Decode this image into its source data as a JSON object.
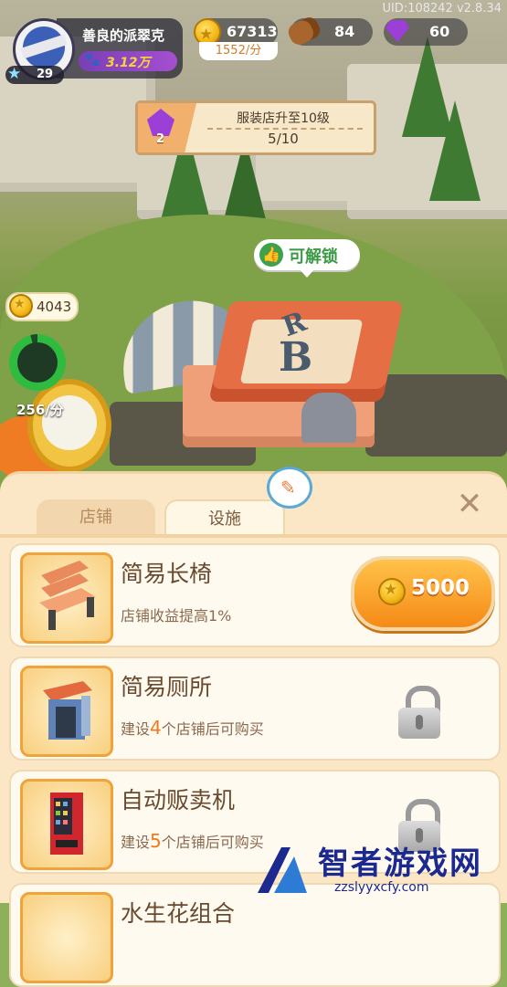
{
  "hud": {
    "uid": "UID:108242 v2.8.34",
    "player_name": "善良的派翠克",
    "fans": "3.12万",
    "level": "29",
    "coins": "67313",
    "coin_rate": "1552/分",
    "wood": "84",
    "gems": "60"
  },
  "quest": {
    "title": "服装店升至10级",
    "progress": "5/10",
    "reward": "2"
  },
  "map": {
    "unlock_label": "可解锁",
    "income_value": "4043",
    "income_rate": "256/分",
    "timer_progress": 0.96
  },
  "panel": {
    "tabs": [
      "店铺",
      "设施"
    ],
    "active_tab": "设施",
    "close_symbol": "✕"
  },
  "items": [
    {
      "name": "简易长椅",
      "desc_prefix": "店铺收益提高1%",
      "desc_num": "",
      "desc_suffix": "",
      "price": "5000",
      "locked": false
    },
    {
      "name": "简易厕所",
      "desc_prefix": "建设",
      "desc_num": "4",
      "desc_suffix": "个店铺后可购买",
      "price": "",
      "locked": true
    },
    {
      "name": "自动贩卖机",
      "desc_prefix": "建设",
      "desc_num": "5",
      "desc_suffix": "个店铺后可购买",
      "price": "",
      "locked": true
    },
    {
      "name": "水生花组合",
      "desc_prefix": "",
      "desc_num": "",
      "desc_suffix": "",
      "price": "",
      "locked": true
    }
  ],
  "watermark": {
    "title": "智者游戏网",
    "url": "zzslyyxcfy.com"
  },
  "colors": {
    "accent_orange": "#f58a16",
    "panel_bg": "#fbe7c6",
    "unlock_green": "#3b9a44",
    "gem_purple": "#9b3fd6"
  }
}
